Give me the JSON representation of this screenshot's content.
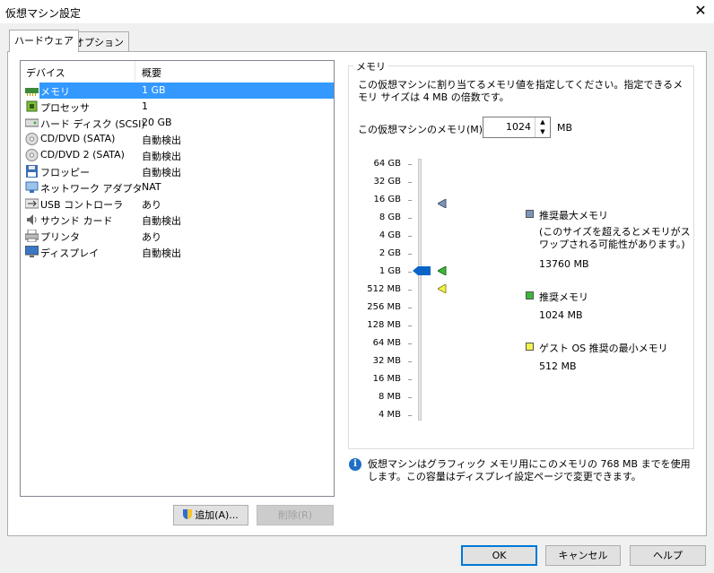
{
  "window": {
    "title": "仮想マシン設定",
    "close_icon": "close-icon"
  },
  "tabs": [
    {
      "label": "ハードウェア",
      "active": true
    },
    {
      "label": "オプション",
      "active": false
    }
  ],
  "device_table": {
    "headers": [
      "デバイス",
      "概要"
    ],
    "rows": [
      {
        "icon": "memory-icon",
        "name": "メモリ",
        "summary": "1 GB",
        "selected": true
      },
      {
        "icon": "processor-icon",
        "name": "プロセッサ",
        "summary": "1"
      },
      {
        "icon": "hard-disk-icon",
        "name": "ハード ディスク (SCSI)",
        "summary": "20 GB"
      },
      {
        "icon": "cd-dvd-icon",
        "name": "CD/DVD (SATA)",
        "summary": "自動検出"
      },
      {
        "icon": "cd-dvd-icon",
        "name": "CD/DVD 2 (SATA)",
        "summary": "自動検出"
      },
      {
        "icon": "floppy-icon",
        "name": "フロッピー",
        "summary": "自動検出"
      },
      {
        "icon": "network-adapter-icon",
        "name": "ネットワーク アダプタ",
        "summary": "NAT"
      },
      {
        "icon": "usb-icon",
        "name": "USB コントローラ",
        "summary": "あり"
      },
      {
        "icon": "sound-card-icon",
        "name": "サウンド カード",
        "summary": "自動検出"
      },
      {
        "icon": "printer-icon",
        "name": "プリンタ",
        "summary": "あり"
      },
      {
        "icon": "display-icon",
        "name": "ディスプレイ",
        "summary": "自動検出"
      }
    ]
  },
  "device_buttons": {
    "add": "追加(A)...",
    "remove": "削除(R)"
  },
  "memory": {
    "group_label": "メモリ",
    "description": "この仮想マシンに割り当てるメモリ値を指定してください。指定できるメモリ サイズは 4 MB の倍数です。",
    "field_label": "この仮想マシンのメモリ(M):",
    "value": "1024",
    "unit": "MB",
    "scale_labels": [
      "64 GB",
      "32 GB",
      "16 GB",
      "8 GB",
      "4 GB",
      "2 GB",
      "1 GB",
      "512 MB",
      "256 MB",
      "128 MB",
      "64 MB",
      "32 MB",
      "16 MB",
      "8 MB",
      "4 MB"
    ],
    "legend": [
      {
        "label": "推奨最大メモリ",
        "note": "(このサイズを超えるとメモリがスワップされる可能性があります。)",
        "value": "13760 MB",
        "color": "#7b95b8"
      },
      {
        "label": "推奨メモリ",
        "value": "1024 MB",
        "color": "#3cb83c"
      },
      {
        "label": "ゲスト OS 推奨の最小メモリ",
        "value": "512 MB",
        "color": "#f2f24c"
      }
    ],
    "info_text": "仮想マシンはグラフィック メモリ用にこのメモリの 768 MB までを使用します。この容量はディスプレイ設定ページで変更できます。"
  },
  "footer": {
    "ok": "OK",
    "cancel": "キャンセル",
    "help": "ヘルプ"
  },
  "colors": {
    "selection": "#3399ff",
    "slider_thumb": "#0a64c8",
    "accent": "#0078d7"
  }
}
